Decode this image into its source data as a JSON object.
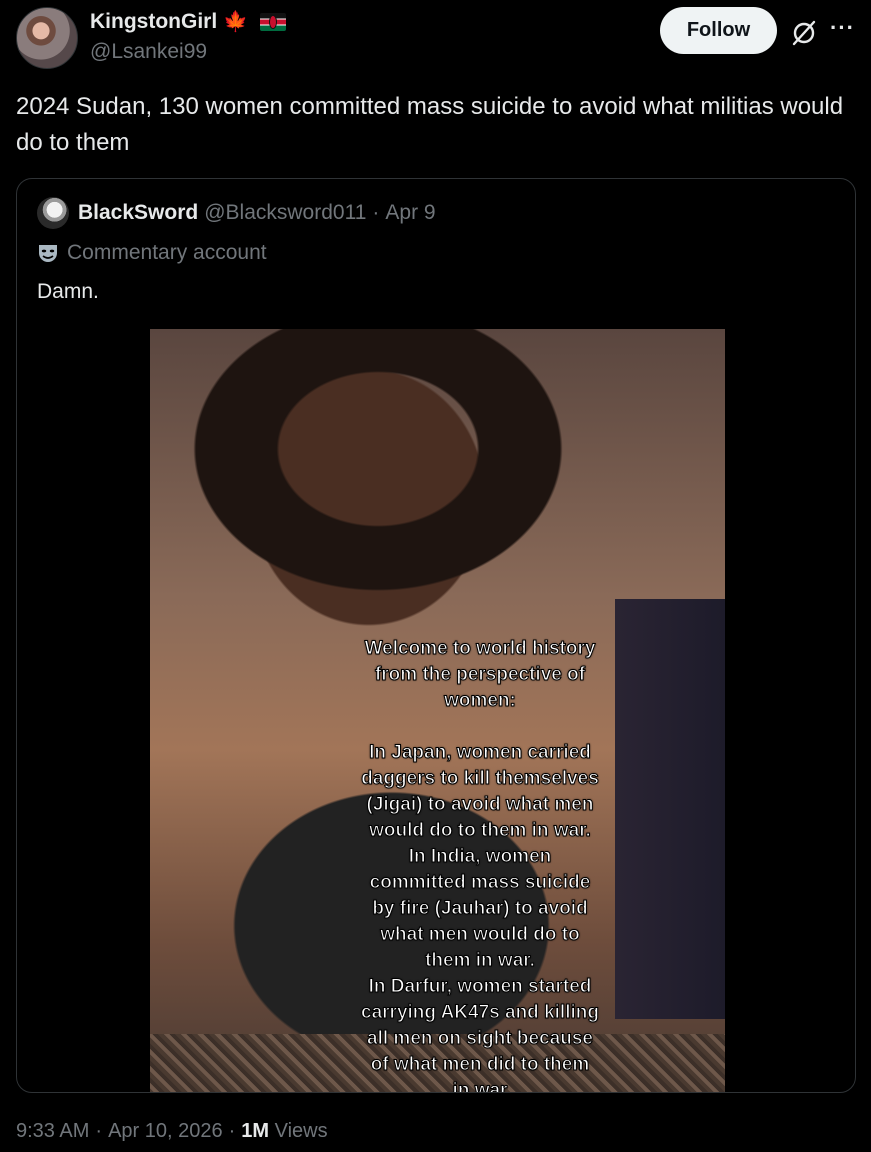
{
  "author": {
    "name": "KingstonGirl",
    "handle": "@Lsankei99",
    "flag_icons": [
      "canada-flag-icon",
      "kenya-flag-icon"
    ]
  },
  "actions": {
    "follow_label": "Follow"
  },
  "tweet": {
    "text": "2024 Sudan, 130 women committed mass suicide to avoid what militias would do to them"
  },
  "quoted": {
    "name": "BlackSword",
    "handle": "@Blacksword011",
    "separator": "·",
    "date": "Apr 9",
    "label": "Commentary account",
    "text": "Damn.",
    "media_caption": "Welcome to world history\nfrom the perspective of\nwomen:\n\nIn Japan, women carried\ndaggers to kill themselves\n(Jigai) to avoid what men\nwould do to them in war.\nIn India, women\ncommitted mass suicide\nby fire (Jauhar) to avoid\nwhat men would do to\nthem in war.\nIn Darfur, women started\ncarrying AK47s and killing\nall men on sight because\nof what men did to them\nin war"
  },
  "meta": {
    "time": "9:33 AM",
    "sep1": "·",
    "date": "Apr 10, 2026",
    "sep2": "·",
    "views_count": "1M",
    "views_label": "Views"
  },
  "colors": {
    "background": "#000000",
    "text": "#e7e9ea",
    "secondary": "#71767b",
    "border": "#2f3336",
    "follow_bg": "#eff3f4"
  }
}
